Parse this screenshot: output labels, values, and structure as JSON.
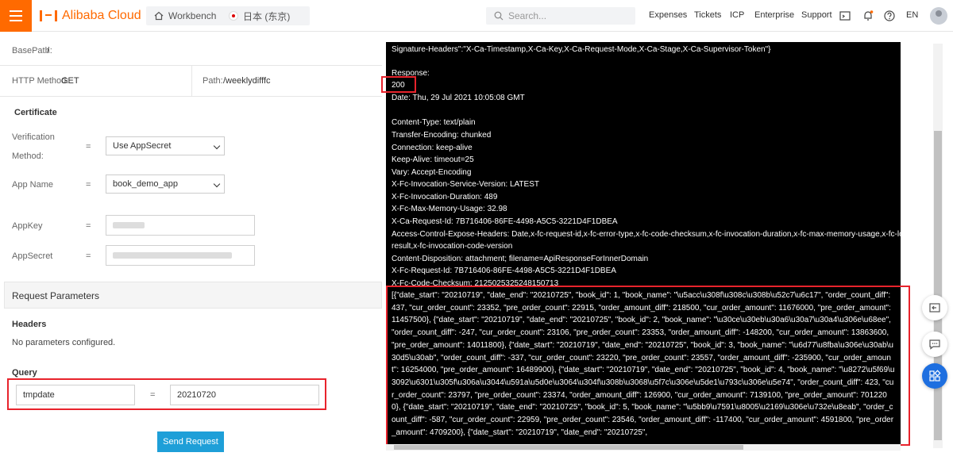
{
  "nav": {
    "brand": "Alibaba Cloud",
    "workbench": "Workbench",
    "region": "日本 (东京)",
    "search_placeholder": "Search...",
    "links": [
      "Expenses",
      "Tickets",
      "ICP",
      "Enterprise",
      "Support"
    ],
    "lang": "EN"
  },
  "form": {
    "basepath_label": "BasePath:",
    "basepath_value": "/",
    "method_label": "HTTP Method:",
    "method_value": "GET",
    "path_label": "Path:",
    "path_value": "/weeklydifffc",
    "certificate_title": "Certificate",
    "verification_label_1": "Verification",
    "verification_label_2": "Method:",
    "verification_value": "Use AppSecret",
    "appname_label": "App Name",
    "appname_value": "book_demo_app",
    "appkey_label": "AppKey",
    "appsecret_label": "AppSecret",
    "eq": "=",
    "request_params_title": "Request Parameters",
    "headers_title": "Headers",
    "headers_empty": "No parameters configured.",
    "query_title": "Query",
    "query_key": "tmpdate",
    "query_value": "20210720",
    "send_button": "Send Request"
  },
  "console": {
    "lines": [
      "Signature-Headers\":\"X-Ca-Timestamp,X-Ca-Key,X-Ca-Request-Mode,X-Ca-Stage,X-Ca-Supervisor-Token\"}",
      "Response:",
      "200",
      "Date: Thu, 29 Jul 2021 10:05:08 GMT",
      "Content-Type: text/plain",
      "Transfer-Encoding: chunked",
      "Connection: keep-alive",
      "Keep-Alive: timeout=25",
      "Vary: Accept-Encoding",
      "X-Fc-Invocation-Service-Version: LATEST",
      "X-Fc-Invocation-Duration: 489",
      "X-Fc-Max-Memory-Usage: 32.98",
      "X-Ca-Request-Id: 7B716406-86FE-4498-A5C5-3221D4F1DBEA",
      "Access-Control-Expose-Headers: Date,x-fc-request-id,x-fc-error-type,x-fc-code-checksum,x-fc-invocation-duration,x-fc-max-memory-usage,x-fc-log-",
      "result,x-fc-invocation-code-version",
      "Content-Disposition: attachment; filename=ApiResponseForInnerDomain",
      "X-Fc-Request-Id: 7B716406-86FE-4498-A5C5-3221D4F1DBEA",
      "X-Fc-Code-Checksum: 2125025325248150713"
    ],
    "body": "[{\"date_start\": \"20210719\", \"date_end\": \"20210725\", \"book_id\": 1, \"book_name\": \"\\u5acc\\u308f\\u308c\\u308b\\u52c7\\u6c17\", \"order_count_diff\": 437, \"cur_order_count\": 23352, \"pre_order_count\": 22915, \"order_amount_diff\": 218500, \"cur_order_amount\": 11676000, \"pre_order_amount\": 11457500}, {\"date_start\": \"20210719\", \"date_end\": \"20210725\", \"book_id\": 2, \"book_name\": \"\\u30ce\\u30eb\\u30a6\\u30a7\\u30a4\\u306e\\u68ee\", \"order_count_diff\": -247, \"cur_order_count\": 23106, \"pre_order_count\": 23353, \"order_amount_diff\": -148200, \"cur_order_amount\": 13863600, \"pre_order_amount\": 14011800}, {\"date_start\": \"20210719\", \"date_end\": \"20210725\", \"book_id\": 3, \"book_name\": \"\\u6d77\\u8fba\\u306e\\u30ab\\u30d5\\u30ab\", \"order_count_diff\": -337, \"cur_order_count\": 23220, \"pre_order_count\": 23557, \"order_amount_diff\": -235900, \"cur_order_amount\": 16254000, \"pre_order_amount\": 16489900}, {\"date_start\": \"20210719\", \"date_end\": \"20210725\", \"book_id\": 4, \"book_name\": \"\\u8272\\u5f69\\u3092\\u6301\\u305f\\u306a\\u3044\\u591a\\u5d0e\\u3064\\u304f\\u308b\\u3068\\u5f7c\\u306e\\u5de1\\u793c\\u306e\\u5e74\", \"order_count_diff\": 423, \"cur_order_count\": 23797, \"pre_order_count\": 23374, \"order_amount_diff\": 126900, \"cur_order_amount\": 7139100, \"pre_order_amount\": 7012200}, {\"date_start\": \"20210719\", \"date_end\": \"20210725\", \"book_id\": 5, \"book_name\": \"\\u5bb9\\u7591\\u8005\\u2169\\u306e\\u732e\\u8eab\", \"order_count_diff\": -587, \"cur_order_count\": 22959, \"pre_order_count\": 23546, \"order_amount_diff\": -117400, \"cur_order_amount\": 4591800, \"pre_order_amount\": 4709200}, {\"date_start\": \"20210719\", \"date_end\": \"20210725\","
  },
  "colors": {
    "brand": "#ff6a00",
    "button": "#1e9fd8",
    "highlight": "#e8232c"
  }
}
